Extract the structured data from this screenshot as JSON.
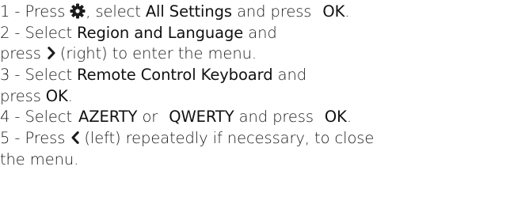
{
  "steps": [
    {
      "line1": {
        "prefix": "1 -  Press",
        "icon": "gear-icon",
        "mid": ", select",
        "term1": "All Settings",
        "after1": " and press",
        "term2": "OK",
        "end": "."
      }
    },
    {
      "line1": {
        "prefix": "2 -  Select",
        "term1": "Region and Language",
        "after1": " and"
      },
      "line2": {
        "prefix": "press",
        "icon": "chevron-right-icon",
        "rest": " (right) to enter the menu."
      }
    },
    {
      "line1": {
        "prefix": "3 -  Select",
        "term1": "Remote Control Keyboard",
        "after1": " and"
      },
      "line2": {
        "prefix": "press",
        "term1": "OK",
        "end": "."
      }
    },
    {
      "line1": {
        "prefix": "4 -  Select",
        "term1": "AZERTY",
        "mid": " or",
        "term2": "QWERTY",
        "after2": " and press",
        "term3": "OK",
        "end": "."
      }
    },
    {
      "line1": {
        "prefix": "5 -  Press",
        "icon": "chevron-left-icon",
        "rest": " (left) repeatedly if necessary, to close"
      },
      "line2": {
        "text": "the menu."
      }
    }
  ],
  "colors": {
    "text": "#1b1b1b",
    "emphasis": "#111111",
    "background": "#ffffff"
  }
}
